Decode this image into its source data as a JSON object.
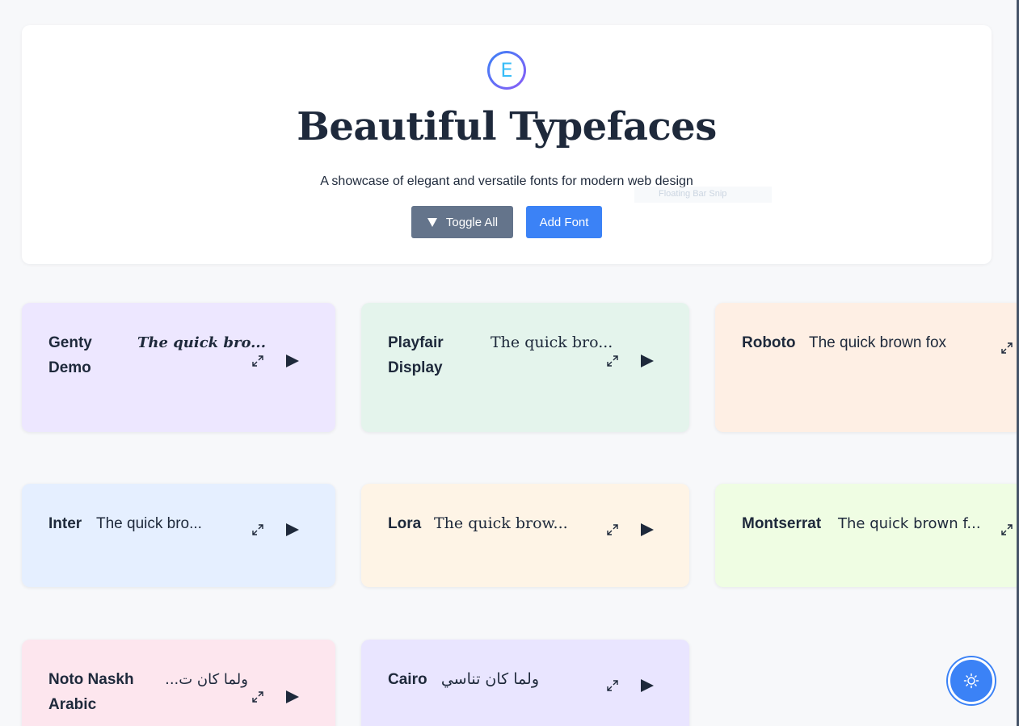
{
  "header": {
    "logo_letter": "E",
    "title": "Beautiful Typefaces",
    "subtitle": "A showcase of elegant and versatile fonts for modern web design",
    "ghost_text": "Floating Bar Snip",
    "toggle_label": "Toggle All",
    "add_label": "Add Font"
  },
  "cards": [
    {
      "name": "Genty Demo",
      "sample": "The quick bro...",
      "color": "#ede7ff"
    },
    {
      "name": "Playfair Display",
      "sample": "The quick bro...",
      "color": "#e4f4ec"
    },
    {
      "name": "Roboto",
      "sample": "The quick brown fox",
      "color": "#feefe4"
    },
    {
      "name": "Inter",
      "sample": "The quick bro...",
      "color": "#e5efff"
    },
    {
      "name": "Lora",
      "sample": "The quick brow...",
      "color": "#fef4e6"
    },
    {
      "name": "Montserrat",
      "sample": "The quick brown f...",
      "color": "#effde3"
    },
    {
      "name": "Noto Naskh Arabic",
      "sample": "ولما كان ت...",
      "color": "#fde6ee"
    },
    {
      "name": "Cairo",
      "sample": "ولما كان تناسي",
      "color": "#e9e5ff"
    }
  ],
  "icons": {
    "expand": "expand-icon",
    "play": "play-icon",
    "theme": "sun-icon",
    "toggle": "triangle-down-icon"
  },
  "colors": {
    "primary": "#3b82f6",
    "secondary": "#64748b",
    "text": "#1e293b",
    "background": "#f7f8fa"
  }
}
